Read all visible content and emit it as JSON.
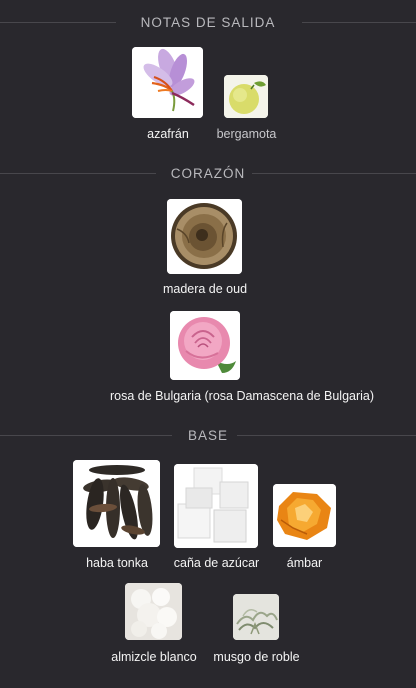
{
  "sections": [
    {
      "title": "NOTAS DE SALIDA",
      "notes": [
        {
          "label": "azafrán",
          "icon": "saffron-flower-image"
        },
        {
          "label": "bergamota",
          "icon": "bergamot-fruit-image"
        }
      ]
    },
    {
      "title": "CORAZÓN",
      "notes": [
        {
          "label": "madera de oud",
          "icon": "oud-wood-image"
        },
        {
          "label": "rosa de Bulgaria (rosa Damascena de Bulgaria)",
          "icon": "bulgarian-rose-image"
        }
      ]
    },
    {
      "title": "BASE",
      "notes": [
        {
          "label": "haba tonka",
          "icon": "tonka-bean-image"
        },
        {
          "label": "caña de azúcar",
          "icon": "sugar-cane-image"
        },
        {
          "label": "ámbar",
          "icon": "amber-image"
        },
        {
          "label": "almizcle blanco",
          "icon": "white-musk-image"
        },
        {
          "label": "musgo de roble",
          "icon": "oakmoss-image"
        }
      ]
    }
  ],
  "colors": {
    "background": "#29282d",
    "header_text": "#b9b9bd",
    "divider": "#48474c",
    "label_text": "#f4f4f4"
  }
}
